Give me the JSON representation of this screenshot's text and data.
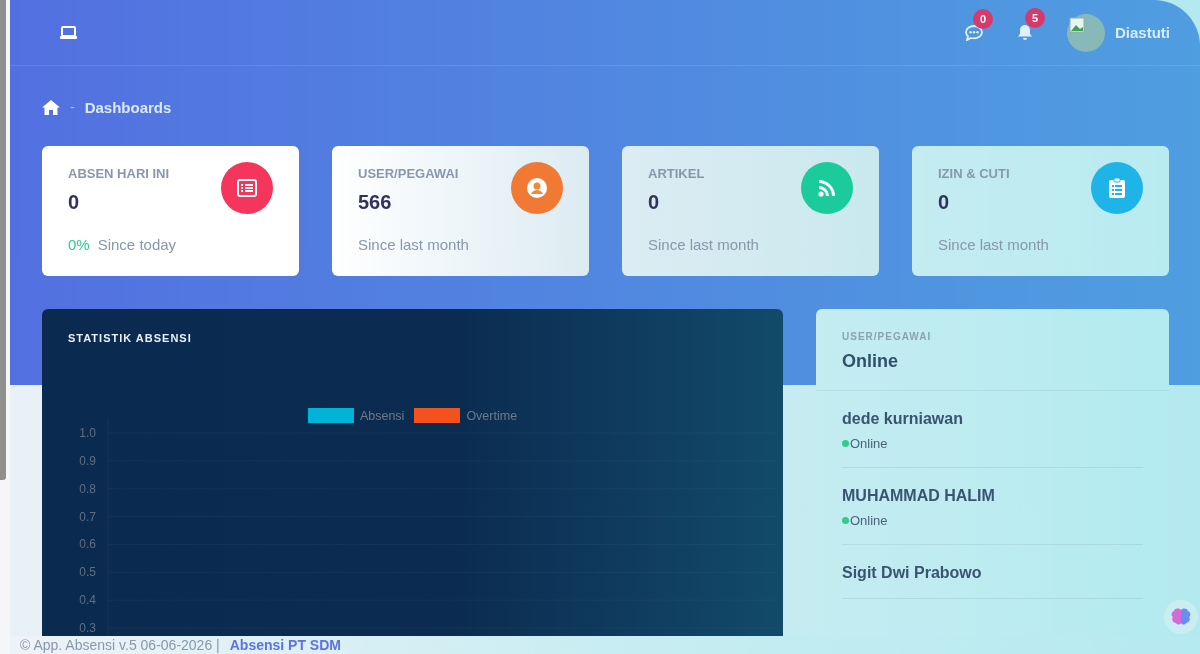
{
  "navbar": {
    "messages": {
      "count": "0"
    },
    "notifications": {
      "count": "5"
    },
    "user": {
      "name": "Diastuti"
    }
  },
  "breadcrumb": {
    "separator": "-",
    "current": "Dashboards"
  },
  "stats": [
    {
      "title": "ABSEN HARI INI",
      "value": "0",
      "change": "0%",
      "caption": "Since today",
      "kind": "list",
      "color": "#f5365c"
    },
    {
      "title": "USER/PEGAWAI",
      "value": "566",
      "caption": "Since last month",
      "kind": "user",
      "color": "#f07a34"
    },
    {
      "title": "ARTIKEL",
      "value": "0",
      "caption": "Since last month",
      "kind": "rss",
      "color": "#1ccb9c"
    },
    {
      "title": "IZIN & CUTI",
      "value": "0",
      "caption": "Since last month",
      "kind": "clipboard",
      "color": "#1eb4e8"
    }
  ],
  "attendance_chart": {
    "title": "STATISTIK ABSENSI",
    "chart_data": {
      "type": "bar",
      "series": [
        {
          "name": "Absensi",
          "color": "#00b4d8"
        },
        {
          "name": "Overtime",
          "color": "#f4511e"
        }
      ],
      "ylim": [
        0,
        1
      ],
      "grid": true,
      "yticks": [
        {
          "value": 1,
          "label": "1.0"
        },
        {
          "value": 0.9,
          "label": "0.9"
        },
        {
          "value": 0.8,
          "label": "0.8"
        },
        {
          "value": 0.7,
          "label": "0.7"
        },
        {
          "value": 0.6,
          "label": "0.6"
        },
        {
          "value": 0.5,
          "label": "0.5"
        },
        {
          "value": 0.4,
          "label": "0.4"
        },
        {
          "value": 0.3,
          "label": "0.3"
        }
      ]
    }
  },
  "online_panel": {
    "subtitle": "USER/PEGAWAI",
    "title": "Online",
    "users": [
      {
        "name": "dede kurniawan",
        "status": "Online",
        "online": true
      },
      {
        "name": "MUHAMMAD HALIM",
        "status": "Online",
        "online": true
      },
      {
        "name": "Sigit Dwi Prabowo"
      }
    ]
  },
  "footer": {
    "text": "© App. Absensi v.5 06-06-2026 |",
    "link": "Absensi PT SDM"
  }
}
